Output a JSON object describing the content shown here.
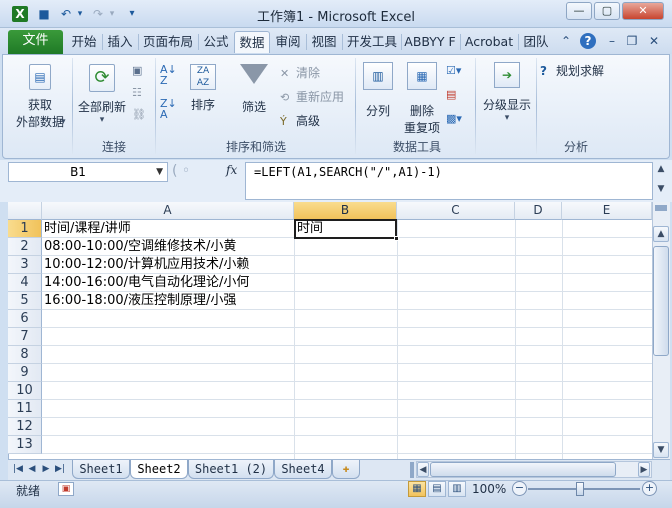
{
  "window": {
    "title": "工作簿1 - Microsoft Excel",
    "minimize": "—",
    "maximize": "▢",
    "close": "✕"
  },
  "quick_access": {
    "excel": "X",
    "save": "■",
    "undo": "↶",
    "redo": "↷",
    "customize": "▾"
  },
  "tabs": {
    "file": "文件",
    "items": [
      "开始",
      "插入",
      "页面布局",
      "公式",
      "数据",
      "审阅",
      "视图",
      "开发工具",
      "ABBYY F",
      "Acrobat",
      "团队"
    ],
    "active": "数据"
  },
  "ribbon": {
    "get_data_line1": "获取",
    "get_data_line2": "外部数据",
    "refresh_all": "全部刷新",
    "connections_group": "连接",
    "sort": "排序",
    "filter": "筛选",
    "clear": "清除",
    "reapply": "重新应用",
    "advanced": "高级",
    "sort_filter_group": "排序和筛选",
    "text_to_columns": "分列",
    "remove_dupes_line1": "删除",
    "remove_dupes_line2": "重复项",
    "data_tools_group": "数据工具",
    "outline": "分级显示",
    "solver": "规划求解",
    "analysis_group": "分析"
  },
  "formula_bar": {
    "name_box": "B1",
    "fx": "fx",
    "formula": "=LEFT(A1,SEARCH(\"/\",A1)-1)"
  },
  "grid": {
    "columns": [
      "A",
      "B",
      "C",
      "D",
      "E"
    ],
    "rows": [
      "1",
      "2",
      "3",
      "4",
      "5",
      "6",
      "7",
      "8",
      "9",
      "10",
      "11",
      "12",
      "13"
    ],
    "selected": "B1",
    "cells": {
      "A1": "时间/课程/讲师",
      "A2": "08:00-10:00/空调维修技术/小黄",
      "A3": "10:00-12:00/计算机应用技术/小赖",
      "A4": "14:00-16:00/电气自动化理论/小何",
      "A5": "16:00-18:00/液压控制原理/小强",
      "B1": "时间"
    }
  },
  "sheets": {
    "tabs": [
      "Sheet1",
      "Sheet2",
      "Sheet1 (2)",
      "Sheet4"
    ],
    "active": "Sheet2"
  },
  "status": {
    "ready": "就绪",
    "zoom": "100%",
    "zoom_out": "−",
    "zoom_in": "+"
  }
}
